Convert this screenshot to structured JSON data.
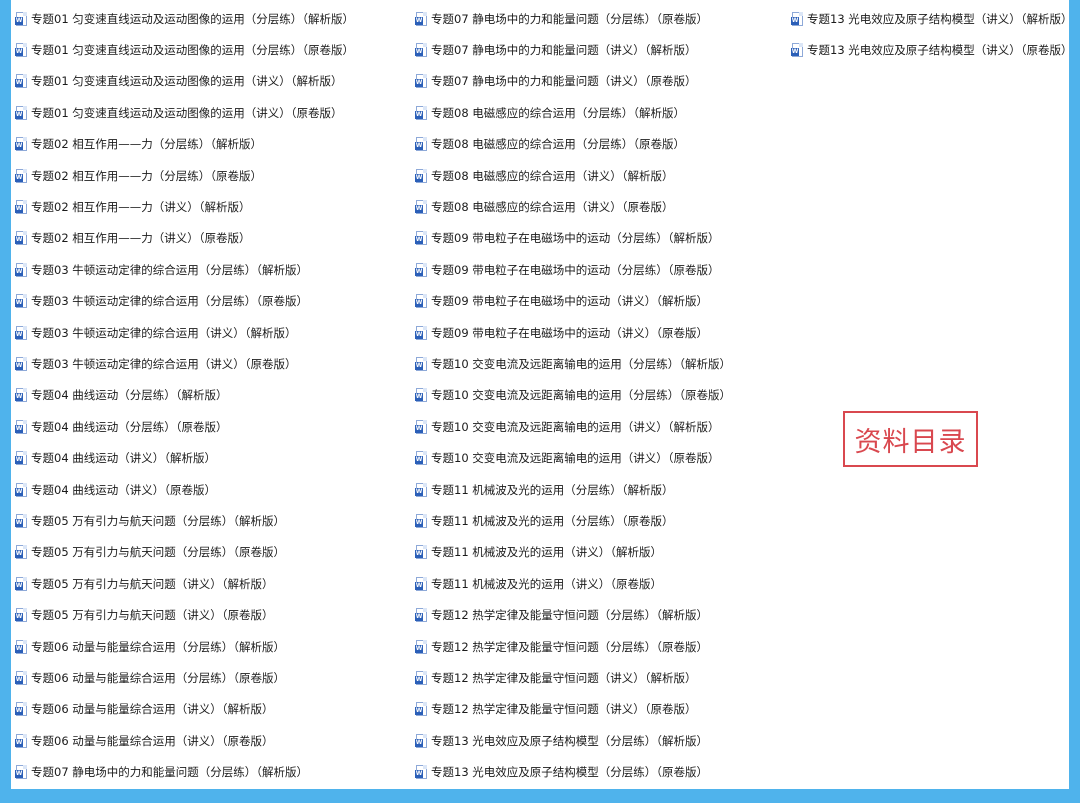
{
  "files": {
    "column1": [
      "专题01 匀变速直线运动及运动图像的运用（分层练）（解析版）",
      "专题01 匀变速直线运动及运动图像的运用（分层练）（原卷版）",
      "专题01 匀变速直线运动及运动图像的运用（讲义）（解析版）",
      "专题01 匀变速直线运动及运动图像的运用（讲义）（原卷版）",
      "专题02 相互作用——力（分层练）（解析版）",
      "专题02 相互作用——力（分层练）（原卷版）",
      "专题02 相互作用——力（讲义）（解析版）",
      "专题02 相互作用——力（讲义）（原卷版）",
      "专题03 牛顿运动定律的综合运用（分层练）（解析版）",
      "专题03 牛顿运动定律的综合运用（分层练）（原卷版）",
      "专题03 牛顿运动定律的综合运用（讲义）（解析版）",
      "专题03 牛顿运动定律的综合运用（讲义）（原卷版）",
      "专题04 曲线运动（分层练）（解析版）",
      "专题04 曲线运动（分层练）（原卷版）",
      "专题04 曲线运动（讲义）（解析版）",
      "专题04 曲线运动（讲义）（原卷版）",
      "专题05 万有引力与航天问题（分层练）（解析版）",
      "专题05 万有引力与航天问题（分层练）（原卷版）",
      "专题05 万有引力与航天问题（讲义）（解析版）",
      "专题05 万有引力与航天问题（讲义）（原卷版）",
      "专题06 动量与能量综合运用（分层练）（解析版）",
      "专题06 动量与能量综合运用（分层练）（原卷版）",
      "专题06 动量与能量综合运用（讲义）（解析版）",
      "专题06 动量与能量综合运用（讲义）（原卷版）",
      "专题07 静电场中的力和能量问题（分层练）（解析版）"
    ],
    "column2": [
      "专题07 静电场中的力和能量问题（分层练）（原卷版）",
      "专题07 静电场中的力和能量问题（讲义）（解析版）",
      "专题07 静电场中的力和能量问题（讲义）（原卷版）",
      "专题08 电磁感应的综合运用（分层练）（解析版）",
      "专题08 电磁感应的综合运用（分层练）（原卷版）",
      "专题08 电磁感应的综合运用（讲义）（解析版）",
      "专题08 电磁感应的综合运用（讲义）（原卷版）",
      "专题09 带电粒子在电磁场中的运动（分层练）（解析版）",
      "专题09 带电粒子在电磁场中的运动（分层练）（原卷版）",
      "专题09 带电粒子在电磁场中的运动（讲义）（解析版）",
      "专题09 带电粒子在电磁场中的运动（讲义）（原卷版）",
      "专题10 交变电流及远距离输电的运用（分层练）（解析版）",
      "专题10 交变电流及远距离输电的运用（分层练）（原卷版）",
      "专题10 交变电流及远距离输电的运用（讲义）（解析版）",
      "专题10 交变电流及远距离输电的运用（讲义）（原卷版）",
      "专题11 机械波及光的运用（分层练）（解析版）",
      "专题11 机械波及光的运用（分层练）（原卷版）",
      "专题11 机械波及光的运用（讲义）（解析版）",
      "专题11 机械波及光的运用（讲义）（原卷版）",
      "专题12 热学定律及能量守恒问题（分层练）（解析版）",
      "专题12 热学定律及能量守恒问题（分层练）（原卷版）",
      "专题12 热学定律及能量守恒问题（讲义）（解析版）",
      "专题12 热学定律及能量守恒问题（讲义）（原卷版）",
      "专题13 光电效应及原子结构模型（分层练）（解析版）",
      "专题13 光电效应及原子结构模型（分层练）（原卷版）"
    ],
    "column3": [
      "专题13 光电效应及原子结构模型（讲义）（解析版）",
      "专题13 光电效应及原子结构模型（讲义）（原卷版）"
    ]
  },
  "file_icon": {
    "name": "word-document-icon",
    "badge": "W"
  },
  "stamp": {
    "text": "资料目录"
  },
  "colors": {
    "frame": "#4fb3ec",
    "stamp": "#d9484f",
    "icon": "#2b5fb8"
  }
}
